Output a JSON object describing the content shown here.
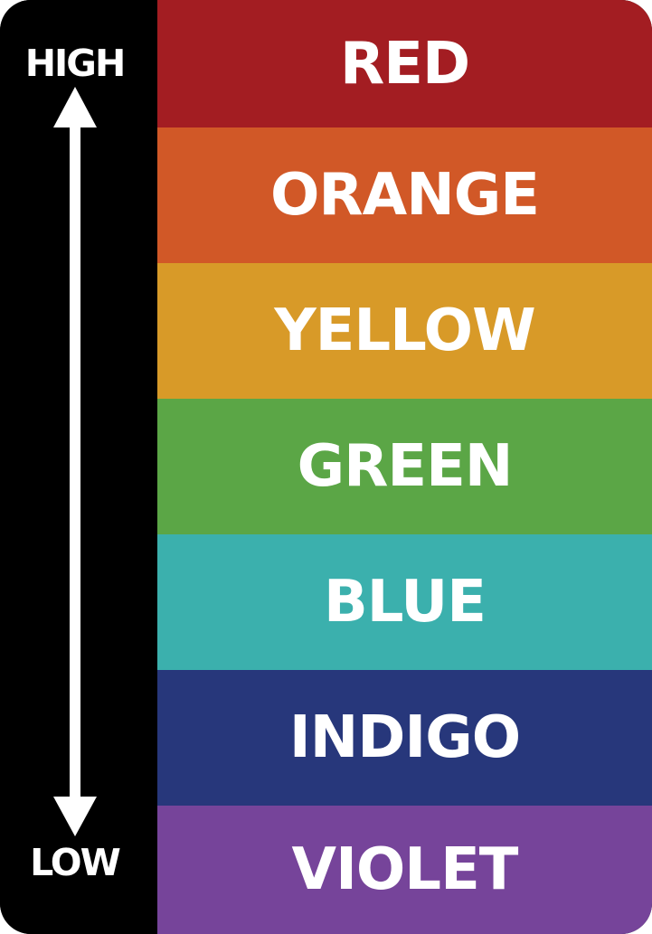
{
  "scale": {
    "high_label": "HIGH",
    "low_label": "LOW"
  },
  "bands": [
    {
      "label": "RED",
      "color": "#A31D22"
    },
    {
      "label": "ORANGE",
      "color": "#D15827"
    },
    {
      "label": "YELLOW",
      "color": "#D89A28"
    },
    {
      "label": "GREEN",
      "color": "#5BA646"
    },
    {
      "label": "BLUE",
      "color": "#3BB0AD"
    },
    {
      "label": "INDIGO",
      "color": "#27377B"
    },
    {
      "label": "VIOLET",
      "color": "#76449A"
    }
  ],
  "colors": {
    "background": "#000000",
    "text": "#FFFFFF",
    "arrow": "#FFFFFF"
  },
  "icons": {
    "arrow": "double-headed-vertical-arrow-icon"
  }
}
